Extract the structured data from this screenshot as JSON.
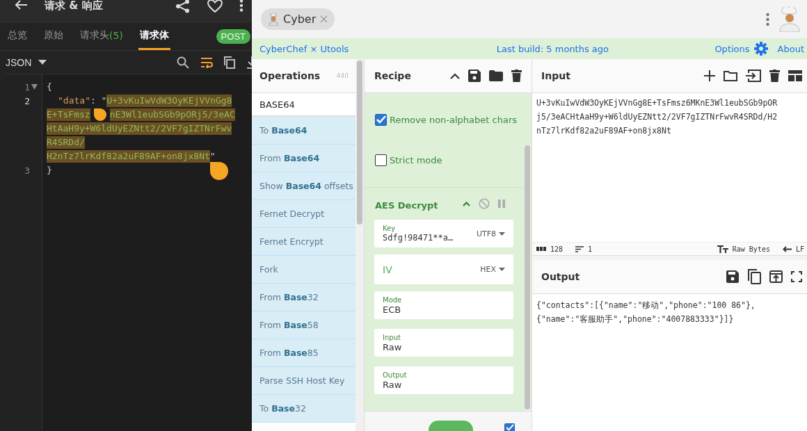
{
  "left_app": {
    "title": "请求 & 响应",
    "tabs": [
      {
        "label": "总览",
        "selected": false
      },
      {
        "label": "原始",
        "selected": false
      },
      {
        "label": "请求头",
        "count": "(5)",
        "selected": false
      },
      {
        "label": "请求体",
        "selected": true
      }
    ],
    "method": "POST",
    "format": "JSON",
    "wrap_on": true,
    "editor": {
      "lines": [
        {
          "number": "1",
          "foldable": true,
          "text": "{"
        },
        {
          "number": "2",
          "foldable": false,
          "key": "\"data\"",
          "separator": ": \"",
          "closing": "\"",
          "value_rows": [
            [
              "U+3vKuIwVdW3OyKEjVVnGg8"
            ],
            [
              "E+TsFmsz",
              "nE3Wl1eubSGb9pORj5/3eAC"
            ],
            [
              "HtAaH9y+W6ldUyEZNtt2/2VF7gIZTNrFwv"
            ],
            [
              "R4SRDd/"
            ],
            [
              "H2nTz7lrKdf82a2uF89AF+on8jx8Nt"
            ]
          ]
        },
        {
          "number": "3",
          "foldable": false,
          "text": "}"
        }
      ]
    }
  },
  "right_app": {
    "tab": {
      "label": "Cyber"
    },
    "banner": {
      "brand": "CyberChef × Utools",
      "build": "Last build: 5 months ago",
      "options": "Options",
      "about": "About"
    },
    "operations": {
      "title": "Operations",
      "count": "440",
      "search": "BASE64",
      "items": [
        "To **Base64**",
        "From **Base64**",
        "Show **Base64** offsets",
        "Fernet Decrypt",
        "Fernet Encrypt",
        "Fork",
        "From **Base**32",
        "From **Base**58",
        "From **Base**85",
        "Parse SSH Host Key",
        "To **Base**32"
      ]
    },
    "recipe": {
      "title": "Recipe",
      "options": [
        {
          "label": "Remove non-alphabet chars",
          "checked": true
        },
        {
          "label": "Strict mode",
          "checked": false
        }
      ],
      "operation": {
        "title": "AES Decrypt",
        "fields": [
          {
            "kind": "text",
            "label": "Key",
            "value": "Sdfg!98471**a…",
            "encoding": "UTF8"
          },
          {
            "kind": "empty",
            "placeholder": "IV",
            "encoding": "HEX"
          },
          {
            "kind": "select",
            "label": "Mode",
            "value": "ECB"
          },
          {
            "kind": "select",
            "label": "Input",
            "value": "Raw"
          },
          {
            "kind": "select",
            "label": "Output",
            "value": "Raw"
          }
        ]
      },
      "auto_bake": true
    },
    "input": {
      "title": "Input",
      "lines": [
        "U+3vKuIwVdW3OyKEjVVnGg8E+TsFmsz6MKnE3Wl1eubSGb9pOR",
        "j5/3eACHtAaH9y+W6ldUyEZNtt2/2VF7gIZTNrFwvR4SRDd/H2",
        "nTz7lrKdf82a2uF89AF+on8jx8Nt"
      ],
      "length": "128",
      "lines_count": "1",
      "encoding": "Raw Bytes",
      "eol": "LF"
    },
    "output": {
      "title": "Output",
      "lines": [
        "{\"contacts\":[{\"name\":\"移动\",\"phone\":\"100 86\"},",
        "{\"name\":\"客服助手\",\"phone\":\"4007883333\"}]}"
      ]
    }
  }
}
